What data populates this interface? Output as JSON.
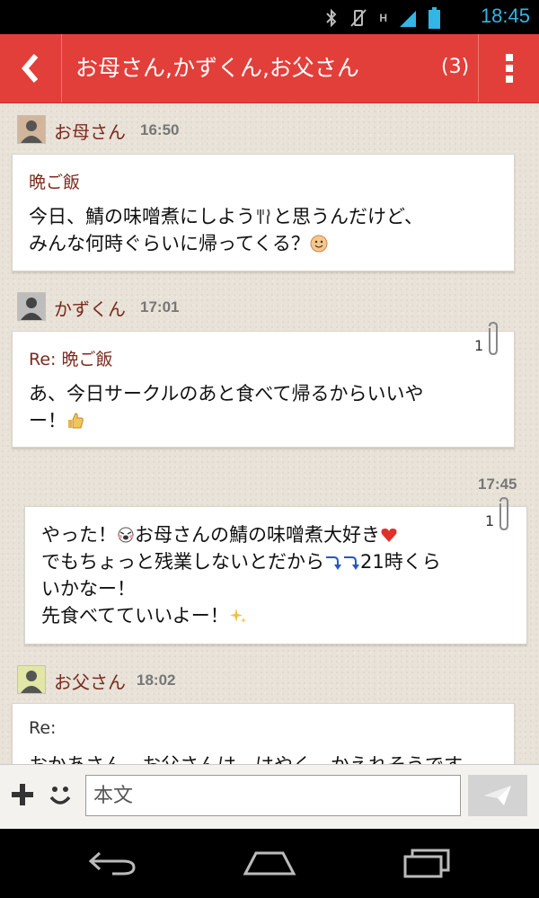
{
  "status_bar": {
    "time": "18:45",
    "network": "H",
    "icons": [
      "bluetooth-icon",
      "vibrate-icon",
      "signal-icon",
      "battery-icon"
    ]
  },
  "header": {
    "title": "お母さん,かずくん,お父さん",
    "count": "(3)",
    "back_icon": "chevron-left-icon",
    "menu_icon": "overflow-menu-icon",
    "bg_color": "#e33f3a"
  },
  "messages": [
    {
      "sender": "お母さん",
      "time": "16:50",
      "subject": "晩ご飯",
      "lines": [
        "今日、鯖の味噌煮にしよう",
        "と思うんだけど、",
        "みんな何時ぐらいに帰ってくる？"
      ],
      "emojis": [
        "fork-knife-icon",
        "smiley-face-icon"
      ]
    },
    {
      "sender": "かずくん",
      "time": "17:01",
      "subject": "Re: 晩ご飯",
      "attachment_count": "1",
      "lines": [
        "あ、今日サークルのあと食べて帰るからいいや",
        "ー！"
      ],
      "emojis": [
        "thumbs-up-icon"
      ]
    },
    {
      "sender": "",
      "time": "17:45",
      "attachment_count": "1",
      "lines": [
        "やった！",
        "お母さんの鯖の味噌煮大好き",
        "でもちょっと残業しないとだから",
        "21時くら",
        "いかなー！",
        "先食べてていいよー！"
      ],
      "emojis": [
        "happy-face-icon",
        "heart-icon",
        "arrow-down-icon",
        "sparkle-icon"
      ]
    },
    {
      "sender": "お父さん",
      "time": "18:02",
      "subject": "Re:",
      "lines": [
        "おかあさん、お父さんは、はやく、かえれそうです"
      ]
    }
  ],
  "composer": {
    "placeholder": "本文",
    "value": "",
    "plus_icon": "plus-icon",
    "emoji_icon": "emoji-icon",
    "send_icon": "send-icon"
  },
  "nav": {
    "icons": [
      "back-icon",
      "home-icon",
      "recent-apps-icon"
    ]
  }
}
